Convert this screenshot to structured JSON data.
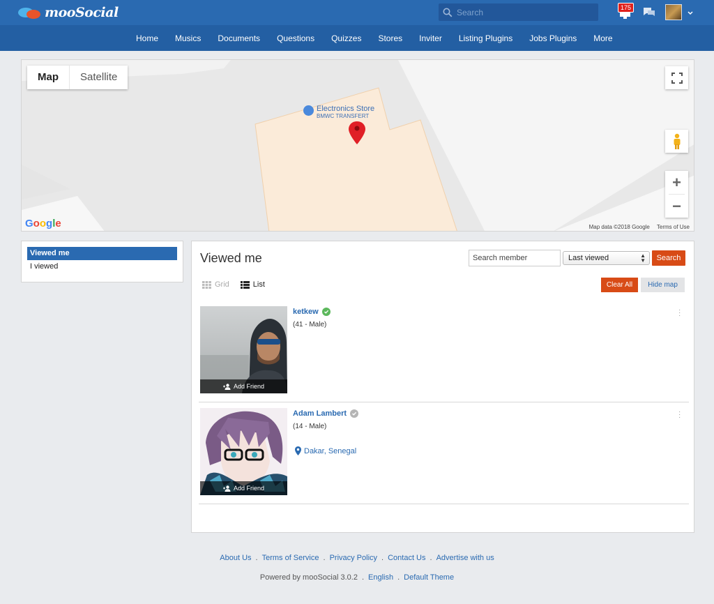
{
  "app": {
    "brand": "mooSocial",
    "search_placeholder": "Search",
    "notification_count": "175"
  },
  "nav": [
    "Home",
    "Musics",
    "Documents",
    "Questions",
    "Quizzes",
    "Stores",
    "Inviter",
    "Listing Plugins",
    "Jobs Plugins",
    "More"
  ],
  "map": {
    "type_map": "Map",
    "type_satellite": "Satellite",
    "place_name": "Electronics Store",
    "place_sub": "BMWC TRANSFERT",
    "google": "Google",
    "data_credit": "Map data ©2018 Google",
    "terms": "Terms of Use"
  },
  "sidebar": {
    "items": [
      "Viewed me",
      "I viewed"
    ]
  },
  "main": {
    "title": "Viewed me",
    "member_search_placeholder": "Search member",
    "sort_value": "Last viewed",
    "search_btn": "Search",
    "grid_label": "Grid",
    "list_label": "List",
    "clear_all": "Clear All",
    "hide_map": "Hide map",
    "add_friend": "Add Friend",
    "members": [
      {
        "name": "ketkew",
        "info": "(41 - Male)",
        "location": ""
      },
      {
        "name": "Adam Lambert",
        "info": "(14 - Male)",
        "location": "Dakar, Senegal"
      }
    ]
  },
  "footer": {
    "links": [
      "About Us",
      "Terms of Service",
      "Privacy Policy",
      "Contact Us",
      "Advertise with us"
    ],
    "powered": "Powered by mooSocial 3.0.2",
    "language": "English",
    "theme": "Default Theme"
  },
  "colors": {
    "header": "#2a6ab1",
    "nav": "#235fa3",
    "accent_orange": "#d84b16",
    "link": "#2a6ab1"
  }
}
